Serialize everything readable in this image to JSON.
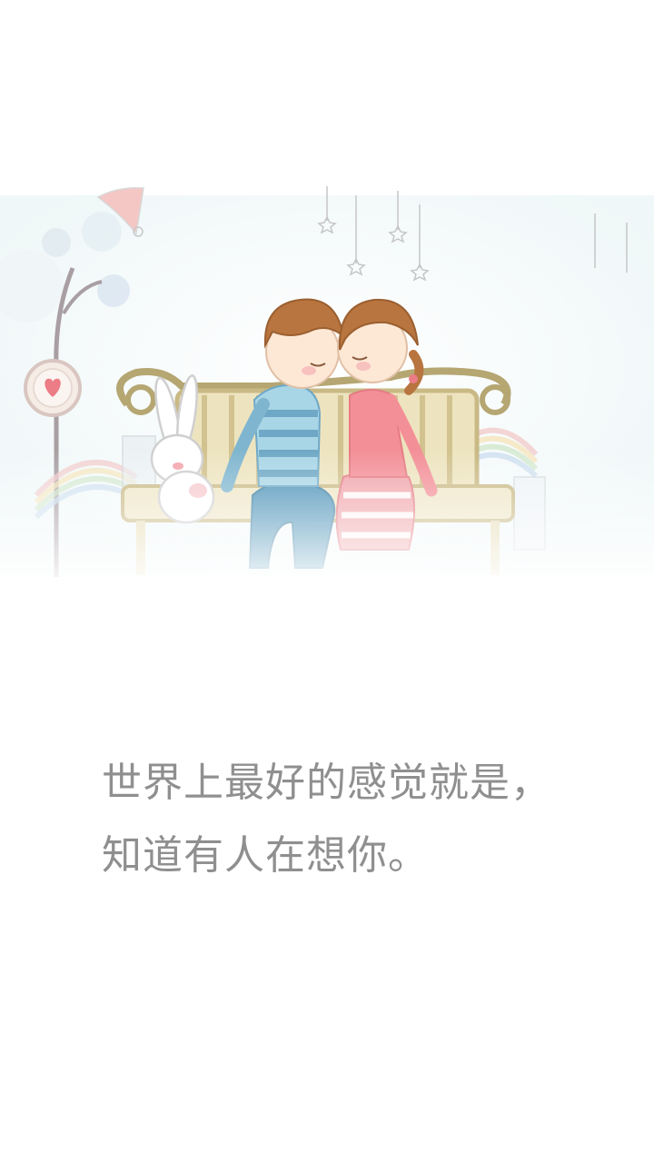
{
  "illustration": {
    "icons": [
      "couple-on-bench-illustration",
      "bunny-icon",
      "heart-icon",
      "star-icon",
      "rainbow-icon"
    ],
    "colors": {
      "boy_shirt": "#6fa8c6",
      "girl_dress": "#e57b84",
      "hair": "#b8753f",
      "bench": "#c9b985",
      "text": "#8f8f8f"
    }
  },
  "quote": {
    "line1": "世界上最好的感觉就是，",
    "line2": "知道有人在想你。"
  }
}
